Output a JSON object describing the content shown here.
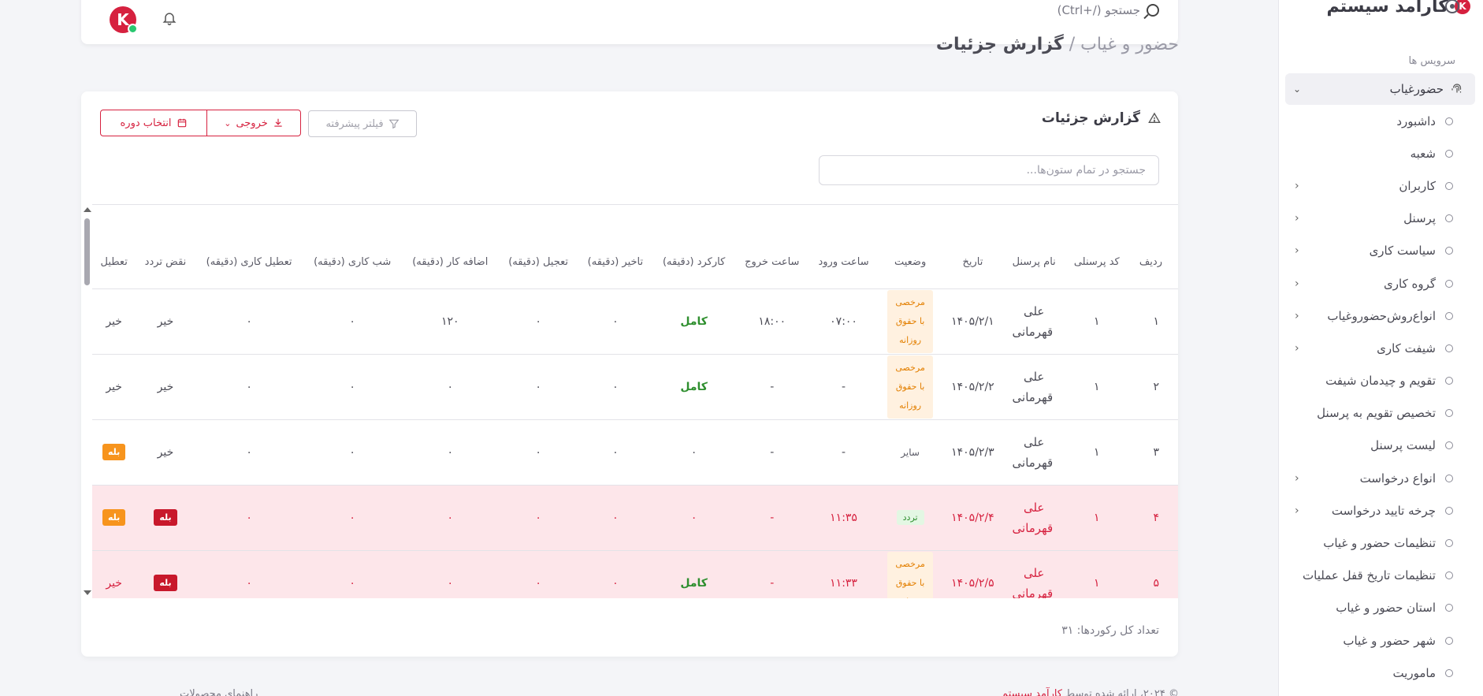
{
  "brand": {
    "name": "کارآمد سیستم",
    "logo_letter": "K"
  },
  "sidebar": {
    "section_title": "سرویس ها",
    "parent": {
      "label": "حضورغیاب",
      "icon": "fingerprint-icon"
    },
    "items": [
      {
        "label": "داشبورد",
        "chevron": false
      },
      {
        "label": "شعبه",
        "chevron": false
      },
      {
        "label": "کاربران",
        "chevron": true
      },
      {
        "label": "پرسنل",
        "chevron": true
      },
      {
        "label": "سیاست کاری",
        "chevron": true
      },
      {
        "label": "گروه کاری",
        "chevron": true
      },
      {
        "label": "انواع‌روش‌حضوروغیاب",
        "chevron": true
      },
      {
        "label": "شیفت کاری",
        "chevron": true
      },
      {
        "label": "تقویم و چیدمان شیفت",
        "chevron": false
      },
      {
        "label": "تخصیص تقویم به پرسنل",
        "chevron": false
      },
      {
        "label": "لیست پرسنل",
        "chevron": false
      },
      {
        "label": "انواع درخواست",
        "chevron": true
      },
      {
        "label": "چرخه تایید درخواست",
        "chevron": true
      },
      {
        "label": "تنظیمات حضور و غیاب",
        "chevron": false
      },
      {
        "label": "تنظیمات تاریخ قفل عملیات",
        "chevron": false
      },
      {
        "label": "استان حضور و غیاب",
        "chevron": false
      },
      {
        "label": "شهر حضور و غیاب",
        "chevron": false
      },
      {
        "label": "ماموریت",
        "chevron": false
      }
    ]
  },
  "topbar": {
    "search_label": "جستجو (/+Ctrl)",
    "avatar_letter": "K"
  },
  "breadcrumb": {
    "parent": "حضور و غیاب",
    "separator": " / ",
    "current": "گزارش جزئیات"
  },
  "card": {
    "title": "گزارش جزئیات",
    "filter_label": "فیلتر پیشرفته",
    "export_label": "خروجی",
    "period_label": "انتخاب دوره",
    "search_placeholder": "جستجو در تمام ستون‌ها...",
    "records_label": "تعداد کل رکوردها: ۳۱"
  },
  "table": {
    "headers": [
      "ردیف",
      "کد پرسنلی",
      "نام پرسنل",
      "تاریخ",
      "وضعیت",
      "ساعت ورود",
      "ساعت خروج",
      "کارکرد (دقیقه)",
      "تاخیر (دقیقه)",
      "تعجیل (دقیقه)",
      "اضافه کار (دقیقه)",
      "شب کاری (دقیقه)",
      "تعطیل کاری (دقیقه)",
      "نقض تردد",
      "تعطیل"
    ],
    "rows": [
      {
        "row": "۱",
        "code": "۱",
        "name": "علی قهرمانی",
        "date": "۱۴۰۵/۲/۱",
        "status": "مرخصی با حقوق روزانه",
        "status_type": "orange",
        "in": "۰۷:۰۰",
        "out": "۱۸:۰۰",
        "work": "کامل",
        "work_green": true,
        "late": "۰",
        "early": "۰",
        "overtime": "۱۲۰",
        "night": "۰",
        "holiday_work": "۰",
        "violation": "خیر",
        "violation_chip": false,
        "holiday": "خیر",
        "holiday_chip": false,
        "alert": false
      },
      {
        "row": "۲",
        "code": "۱",
        "name": "علی قهرمانی",
        "date": "۱۴۰۵/۲/۲",
        "status": "مرخصی با حقوق روزانه",
        "status_type": "orange",
        "in": "-",
        "out": "-",
        "work": "کامل",
        "work_green": true,
        "late": "۰",
        "early": "۰",
        "overtime": "۰",
        "night": "۰",
        "holiday_work": "۰",
        "violation": "خیر",
        "violation_chip": false,
        "holiday": "خیر",
        "holiday_chip": false,
        "alert": false
      },
      {
        "row": "۳",
        "code": "۱",
        "name": "علی قهرمانی",
        "date": "۱۴۰۵/۲/۳",
        "status": "سایر",
        "status_type": "plain",
        "in": "-",
        "out": "-",
        "work": "۰",
        "work_green": false,
        "late": "۰",
        "early": "۰",
        "overtime": "۰",
        "night": "۰",
        "holiday_work": "۰",
        "violation": "خیر",
        "violation_chip": false,
        "holiday": "بله",
        "holiday_chip": "orange",
        "alert": false
      },
      {
        "row": "۴",
        "code": "۱",
        "name": "علی قهرمانی",
        "date": "۱۴۰۵/۲/۴",
        "status": "تردد",
        "status_type": "green",
        "in": "۱۱:۳۵",
        "out": "-",
        "work": "۰",
        "work_green": false,
        "late": "۰",
        "early": "۰",
        "overtime": "۰",
        "night": "۰",
        "holiday_work": "۰",
        "violation": "بله",
        "violation_chip": "red",
        "holiday": "بله",
        "holiday_chip": "orange",
        "alert": true
      },
      {
        "row": "۵",
        "code": "۱",
        "name": "علی قهرمانی",
        "date": "۱۴۰۵/۲/۵",
        "status": "مرخصی با حقوق روزانه",
        "status_type": "orange",
        "in": "۱۱:۳۳",
        "out": "-",
        "work": "کامل",
        "work_green": true,
        "late": "۰",
        "early": "۰",
        "overtime": "۰",
        "night": "۰",
        "holiday_work": "۰",
        "violation": "بله",
        "violation_chip": "red",
        "holiday": "خیر",
        "holiday_chip": false,
        "alert": true
      }
    ]
  },
  "footer": {
    "text": "© ۲۰۲۴، ارائه شده توسط",
    "link": "کارآمد سیستم",
    "left": "راهنمای محصولات"
  },
  "colors": {
    "brand": "#d6213f",
    "orange": "#f7941d",
    "green": "#2f8f2f",
    "alert_row": "#fde6ea"
  }
}
